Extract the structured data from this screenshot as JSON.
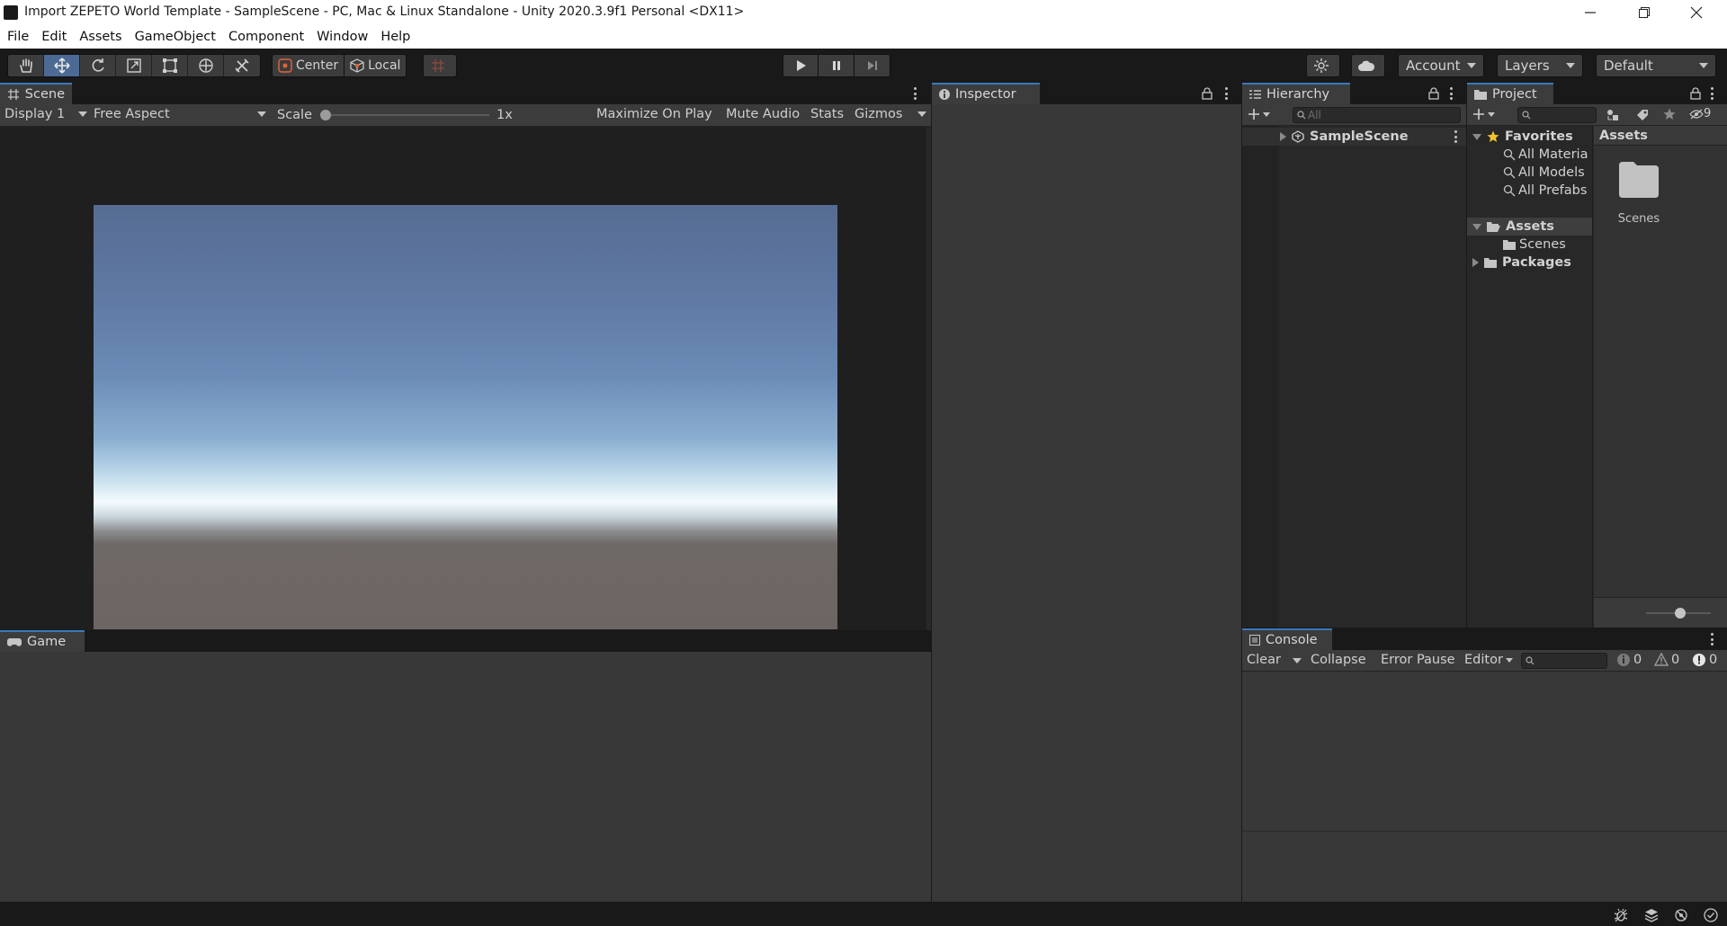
{
  "window": {
    "title": "Import ZEPETO World Template - SampleScene - PC, Mac & Linux Standalone - Unity 2020.3.9f1 Personal <DX11>"
  },
  "menu": [
    "File",
    "Edit",
    "Assets",
    "GameObject",
    "Component",
    "Window",
    "Help"
  ],
  "toolbar": {
    "pivot_label": "Center",
    "space_label": "Local",
    "account_label": "Account",
    "layers_label": "Layers",
    "layout_label": "Default"
  },
  "scene_panel": {
    "tab_label": "Scene",
    "display_label": "Display 1",
    "aspect_label": "Free Aspect",
    "scale_label": "Scale",
    "scale_value": "1x",
    "maximize_label": "Maximize On Play",
    "mute_label": "Mute Audio",
    "stats_label": "Stats",
    "gizmos_label": "Gizmos"
  },
  "game_panel": {
    "tab_label": "Game"
  },
  "inspector": {
    "tab_label": "Inspector"
  },
  "hierarchy": {
    "tab_label": "Hierarchy",
    "search_placeholder": "All",
    "root_item": "SampleScene"
  },
  "project": {
    "tab_label": "Project",
    "favorites_label": "Favorites",
    "favorites": [
      "All Materia",
      "All Models",
      "All Prefabs"
    ],
    "assets_label": "Assets",
    "scenes_label": "Scenes",
    "packages_label": "Packages",
    "breadcrumb": "Assets",
    "folder_item": "Scenes",
    "hidden_count": "9"
  },
  "console": {
    "tab_label": "Console",
    "clear_label": "Clear",
    "collapse_label": "Collapse",
    "error_pause_label": "Error Pause",
    "editor_label": "Editor",
    "info_count": "0",
    "warning_count": "0",
    "error_count": "0"
  },
  "colors": {
    "accent": "#3a79bb",
    "selected_tool": "#4c6a93",
    "panel": "#282828",
    "toolbar": "#3c3c3c"
  }
}
